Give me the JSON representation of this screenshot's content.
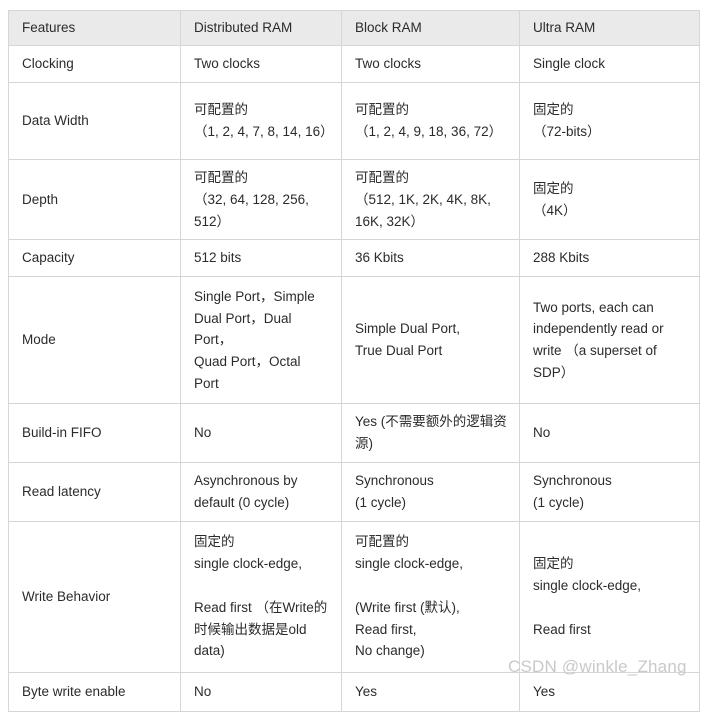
{
  "table": {
    "columns": [
      "Features",
      "Distributed RAM",
      "Block RAM",
      "Ultra RAM"
    ],
    "rows": [
      {
        "feature": "Clocking",
        "distributed_ram": "Two clocks",
        "block_ram": "Two clocks",
        "ultra_ram": "Single clock"
      },
      {
        "feature": "Data Width",
        "distributed_ram": "可配置的\n （1, 2, 4, 7, 8, 14, 16）",
        "block_ram": "可配置的\n （1, 2, 4, 9, 18, 36, 72）",
        "ultra_ram": "固定的\n （72-bits）"
      },
      {
        "feature": "Depth",
        "distributed_ram": "可配置的\n （32, 64, 128, 256, 512）",
        "block_ram": "可配置的\n （512, 1K, 2K, 4K, 8K, 16K, 32K）",
        "ultra_ram": "固定的\n （4K）"
      },
      {
        "feature": "Capacity",
        "distributed_ram": "512 bits",
        "block_ram": "36 Kbits",
        "ultra_ram": "288 Kbits"
      },
      {
        "feature": "Mode",
        "distributed_ram": "Single Port，Simple Dual Port，Dual Port，\nQuad Port，Octal Port",
        "block_ram": "Simple Dual Port,\nTrue Dual Port",
        "ultra_ram": "Two ports, each can independently read or write （a superset of SDP）"
      },
      {
        "feature": "Build-in FIFO",
        "distributed_ram": "No",
        "block_ram": "Yes (不需要额外的逻辑资源)",
        "ultra_ram": "No"
      },
      {
        "feature": "Read latency",
        "distributed_ram": "Asynchronous by default (0 cycle)",
        "block_ram": "Synchronous\n(1 cycle)",
        "ultra_ram": "Synchronous\n(1 cycle)"
      },
      {
        "feature": "Write Behavior",
        "distributed_ram": "固定的\nsingle clock-edge,\n\nRead first  （在Write的时候输出数据是old data)",
        "block_ram": "可配置的\nsingle clock-edge,\n\n(Write first (默认),\nRead first,\nNo change)",
        "ultra_ram": "固定的\nsingle clock-edge,\n\nRead first"
      },
      {
        "feature": "Byte write enable",
        "distributed_ram": "No",
        "block_ram": "Yes",
        "ultra_ram": "Yes"
      }
    ]
  },
  "watermark": {
    "text": "CSDN @winkle_Zhang",
    "color": "#c9c9c9"
  }
}
